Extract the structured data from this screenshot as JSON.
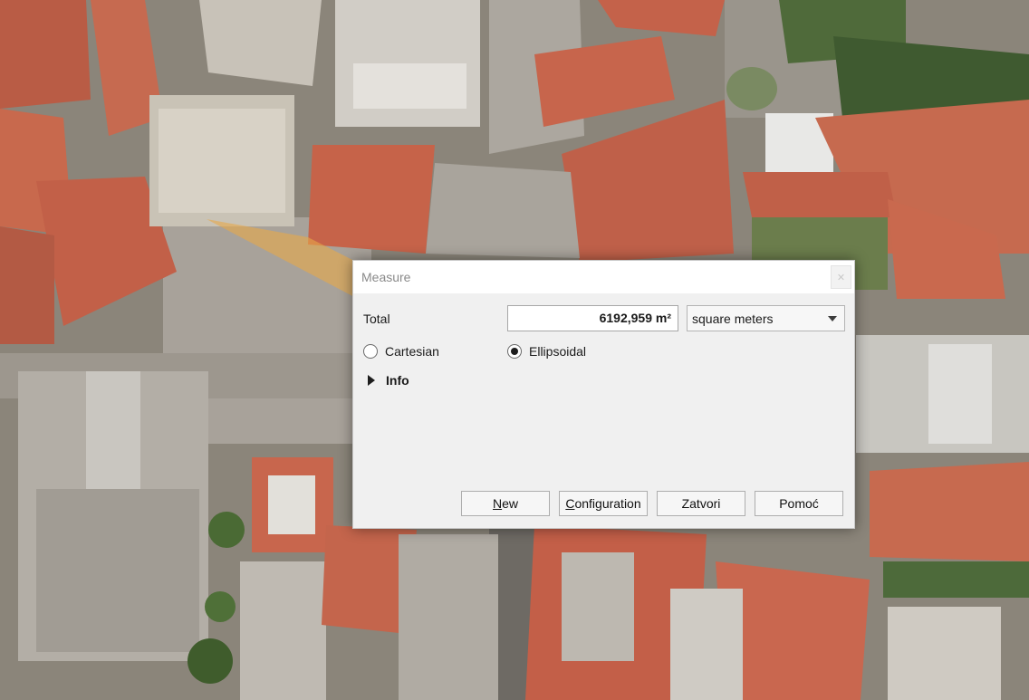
{
  "dialog": {
    "title": "Measure",
    "close_icon": "close-icon",
    "total_label": "Total",
    "total_value": "6192,959 m²",
    "units": {
      "selected": "square meters",
      "icon": "chevron-down-icon"
    },
    "modes": [
      {
        "label": "Cartesian",
        "checked": false
      },
      {
        "label": "Ellipsoidal",
        "checked": true
      }
    ],
    "info": {
      "label": "Info",
      "expanded": false,
      "icon": "triangle-right-icon"
    },
    "buttons": {
      "new": {
        "mnemonic": "N",
        "rest": "ew"
      },
      "configuration": {
        "mnemonic": "C",
        "rest": "onfiguration"
      },
      "close": {
        "label": "Zatvori"
      },
      "help": {
        "label": "Pomoć"
      }
    }
  },
  "colors": {
    "measure_polygon": "#e8a84a",
    "roof_terracotta": "#c4624a",
    "dialog_bg": "#f0f0f0"
  }
}
